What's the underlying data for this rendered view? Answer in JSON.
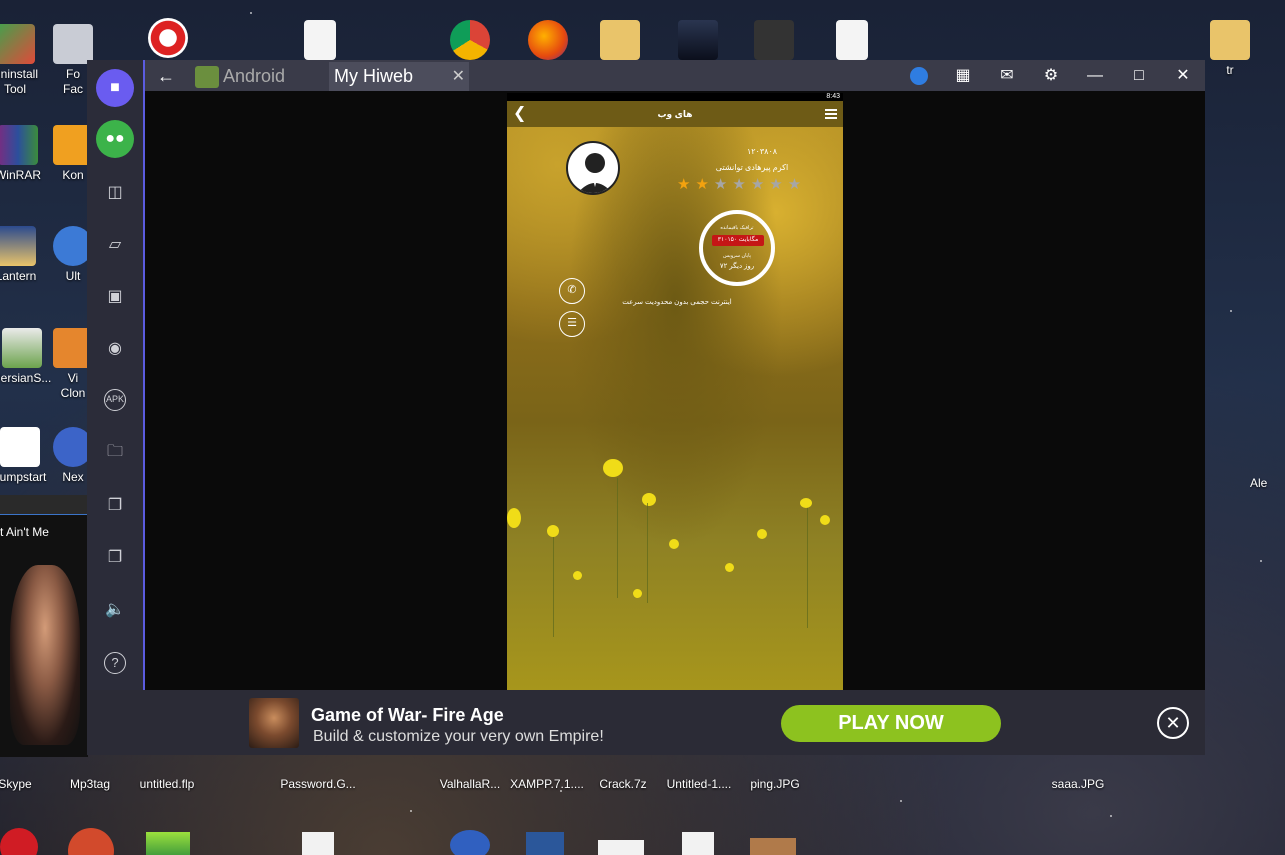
{
  "desktop": {
    "left_icons": [
      {
        "label": "Uninstall",
        "label2": "Tool"
      },
      {
        "label": "WinRAR"
      },
      {
        "label": "Lantern"
      },
      {
        "label": "PersianS..."
      },
      {
        "label": "Jumpstart"
      }
    ],
    "col2_icons": [
      {
        "label": "Fo",
        "label2": "Fac"
      },
      {
        "label": "Kon"
      },
      {
        "label": "Ult"
      },
      {
        "label": "Vi",
        "label2": "Clon"
      },
      {
        "label": "Nex"
      }
    ],
    "right_icons": [
      {
        "label": "tr"
      },
      {
        "label": "Ale"
      }
    ],
    "bottom_icons": [
      {
        "label": "Skype"
      },
      {
        "label": "Mp3tag"
      },
      {
        "label": "untitled.flp"
      },
      {
        "label": "Password.G..."
      },
      {
        "label": "ValhallaR..."
      },
      {
        "label": "XAMPP.7.1...."
      },
      {
        "label": "Crack.7z"
      },
      {
        "label": "Untitled-1...."
      },
      {
        "label": "ping.JPG"
      },
      {
        "label": "saaa.JPG"
      }
    ],
    "media_widget": {
      "song": "t Ain't Me"
    }
  },
  "emulator": {
    "tabs": [
      {
        "label": "Android"
      },
      {
        "label": "My Hiweb"
      }
    ],
    "sidebar_icons": [
      "video-call-icon",
      "chat-icon",
      "multi-window-icon",
      "shake-icon",
      "screenshot-icon",
      "location-icon",
      "apk-icon",
      "folder-icon",
      "copy-icon",
      "paste-icon",
      "volume-icon",
      "help-icon"
    ],
    "window_icons": [
      "account-icon",
      "network-icon",
      "mail-icon",
      "settings-icon",
      "minimize-icon",
      "maximize-icon",
      "close-icon"
    ]
  },
  "phone": {
    "status_time": "8:43",
    "app_title": "های وب",
    "user_id": "۱۲۰۳۸۰۸",
    "user_name": "اکرم پیرهادی توانشتی",
    "rating": {
      "value": 2,
      "max": 7
    },
    "gauge": {
      "label_top": "ترافیک باقیمانده",
      "traffic": "۳۱۰۱۵۰ مگابایت",
      "label_mid": "پایان سرویس",
      "days": "۷۲ روز دیگر"
    },
    "plan": "اینترنت حجمی بدون محدودیت سرعت"
  },
  "ad": {
    "title": "Game of War- Fire Age",
    "subtitle": "Build & customize your very own Empire!",
    "cta": "PLAY NOW"
  },
  "colors": {
    "accent": "#5b5ce0",
    "play_button": "#8dc21f",
    "star_on": "#f3a20f",
    "traffic_badge": "#c51616"
  }
}
